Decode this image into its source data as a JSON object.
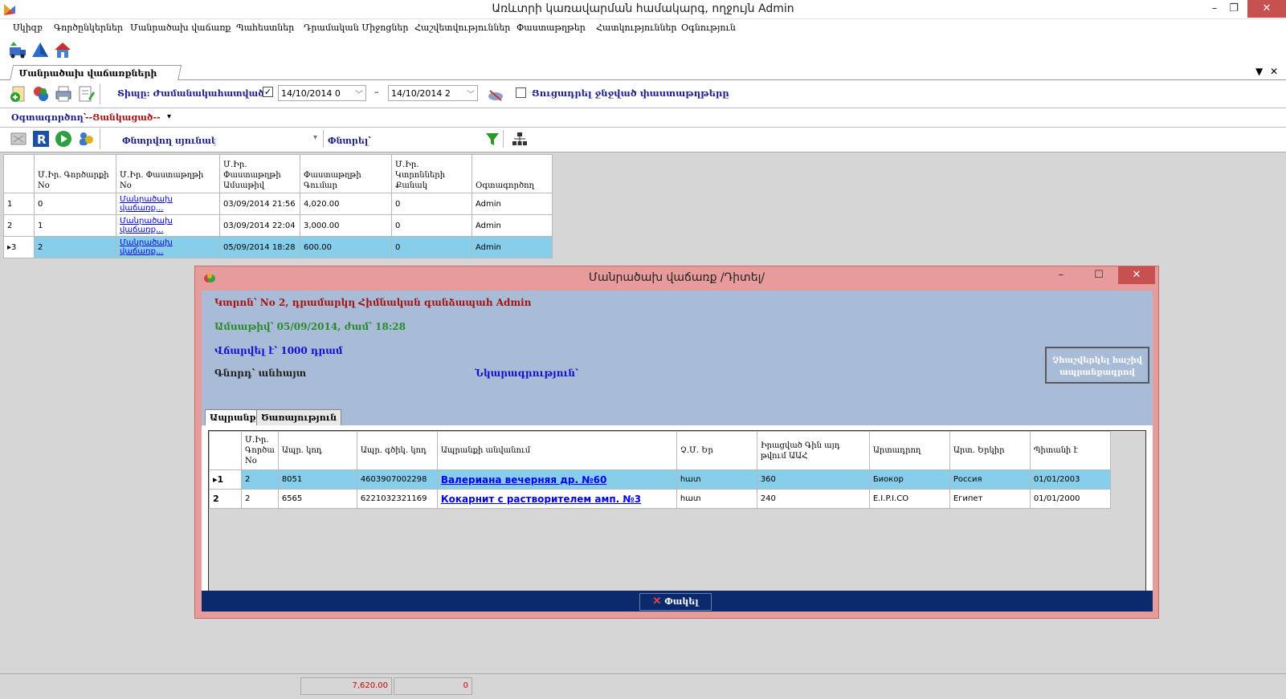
{
  "window": {
    "title": "Առևտրի կառավարման համակարգ, ողջույն Admin",
    "minimize": "–",
    "restore": "❐",
    "close": "✕"
  },
  "menu": [
    "Սկիզբ",
    "Գործընկերներ",
    "Մանրածախ վաճառք",
    "Պահեստներ",
    "Դրամական Միջոցներ",
    "Հաշվետվություններ",
    "Փաստաթղթեր",
    "Հատկություններ",
    "Օգնություն"
  ],
  "tabs": {
    "document_tab": "Մանրածախ վաճառքների ց...",
    "dropdown": "▼",
    "close": "✕"
  },
  "filters": {
    "type_label": "Տիպը: Ժամանակահատված՝",
    "type_checked": "✓",
    "date_from": "14/10/2014 0",
    "dash": "–",
    "date_to": "14/10/2014 2",
    "show_deleted": "Ցուցադրել ջնջված փաստաթղթերը",
    "user_label": "Օգտագործող՝",
    "user_value": "--Ցանկացած--",
    "search_column_label": "Փնտրվող սյունակ՝",
    "search_label": "Փնտրել՝",
    "dropdown_arrow": "▾"
  },
  "main_grid": {
    "headers": [
      "Մ.Իր. Գործարքի No",
      "Մ.Իր. Փաստաթղթի No",
      "Մ.Իր. Փաստաթղթի Ամսաթիվ",
      "Փաստաթղթի Գումար",
      "Մ.Իր. Կտրոնների Քանակ",
      "Օգտագործող"
    ],
    "rows": [
      {
        "num": "1",
        "deal": "0",
        "doc": "Մանրածախ վաճառք...",
        "date": "03/09/2014 21:56",
        "sum": "4,020.00",
        "count": "0",
        "user": "Admin"
      },
      {
        "num": "2",
        "deal": "1",
        "doc": "Մանրածախ վաճառք...",
        "date": "03/09/2014 22:04",
        "sum": "3,000.00",
        "count": "0",
        "user": "Admin"
      },
      {
        "num": "▸3",
        "deal": "2",
        "doc": "Մանրածախ վաճառք...",
        "date": "05/09/2014 18:28",
        "sum": "600.00",
        "count": "0",
        "user": "Admin"
      }
    ]
  },
  "modal": {
    "title": "Մանրածախ վաճառք /Դիտել/",
    "minimize": "–",
    "maximize": "☐",
    "close": "✕",
    "receipt": "Կտրոն՝ No 2, դրամարկղ Հիմնական գանձապահ Admin",
    "date": "Ամսաթիվ՝ 05/09/2014, ժամ՝ 18:28",
    "paid": "Վճարվել է՝ 1000 դրամ",
    "buyer": "Գնորդ՝ անհայտ",
    "description": "Նկարագրություն՝",
    "calc_button": "Չհաշվերկել հաշիվ ապրանքագրով",
    "tabs": [
      "Ապրանք",
      "Ծառայություն"
    ],
    "grid_headers": [
      "Մ.Իր. Գործա No",
      "Ապր. կոդ",
      "Ապր. գծիկ. կոդ",
      "Ապրանքի անվանում",
      "Չ.Մ. Եր",
      "Իրացված Գին այդ թվում ԱԱՀ",
      "Արտադրող",
      "Արտ. Երկիր",
      "Պիտանի է"
    ],
    "grid_rows": [
      {
        "num": "▸1",
        "deal": "2",
        "code": "8051",
        "barcode": "4603907002298",
        "name": "Валериана вечерняя др. №60",
        "unit": "հատ",
        "price": "360",
        "maker": "Биокор",
        "country": "Россия",
        "expiry": "01/01/2003"
      },
      {
        "num": "2",
        "deal": "2",
        "code": "6565",
        "barcode": "6221032321169",
        "name": "Кокарнит с растворителем амп. №3",
        "unit": "հատ",
        "price": "240",
        "maker": "E.I.P.I.CO",
        "country": "Египет",
        "expiry": "01/01/2000"
      }
    ],
    "close_button": "Փակել",
    "close_x": "✕"
  },
  "status": {
    "total": "7,620.00",
    "count": "0"
  },
  "colors": {
    "selection": "#87ceeb",
    "modal_border": "#e89b9b",
    "info_bg": "#a8bcd8",
    "footer": "#0b2a6e",
    "label_blue": "#1d1d8c",
    "label_red": "#a51212"
  }
}
